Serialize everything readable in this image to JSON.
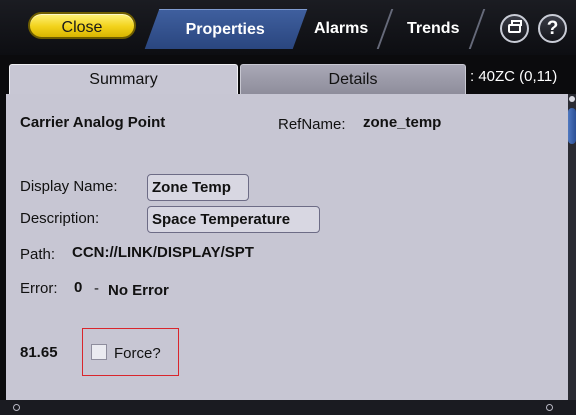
{
  "header": {
    "close_label": "Close",
    "tabs": [
      {
        "label": "Properties",
        "active": true
      },
      {
        "label": "Alarms",
        "active": false
      },
      {
        "label": "Trends",
        "active": false
      }
    ],
    "print_icon": "printer-icon",
    "help_label": "?"
  },
  "subtabs": {
    "items": [
      {
        "label": "Summary",
        "active": true
      },
      {
        "label": "Details",
        "active": false
      }
    ],
    "device_label": ": 40ZC (0,11)"
  },
  "summary": {
    "point_type": "Carrier Analog Point",
    "refname_label": "RefName:",
    "refname_value": "zone_temp",
    "display_name_label": "Display Name:",
    "display_name_value": "Zone Temp",
    "description_label": "Description:",
    "description_value": "Space Temperature",
    "path_label": "Path:",
    "path_value": "CCN://LINK/DISPLAY/SPT",
    "error_label": "Error:",
    "error_code": "0",
    "error_separator": "-",
    "error_text": "No Error",
    "present_value": "81.65",
    "force_label": "Force?",
    "force_checked": false
  },
  "colors": {
    "close_button": "#f2d21a",
    "active_tab": "#2f4f8f",
    "panel_bg": "#c7c6d3",
    "force_highlight": "#d9262c"
  }
}
